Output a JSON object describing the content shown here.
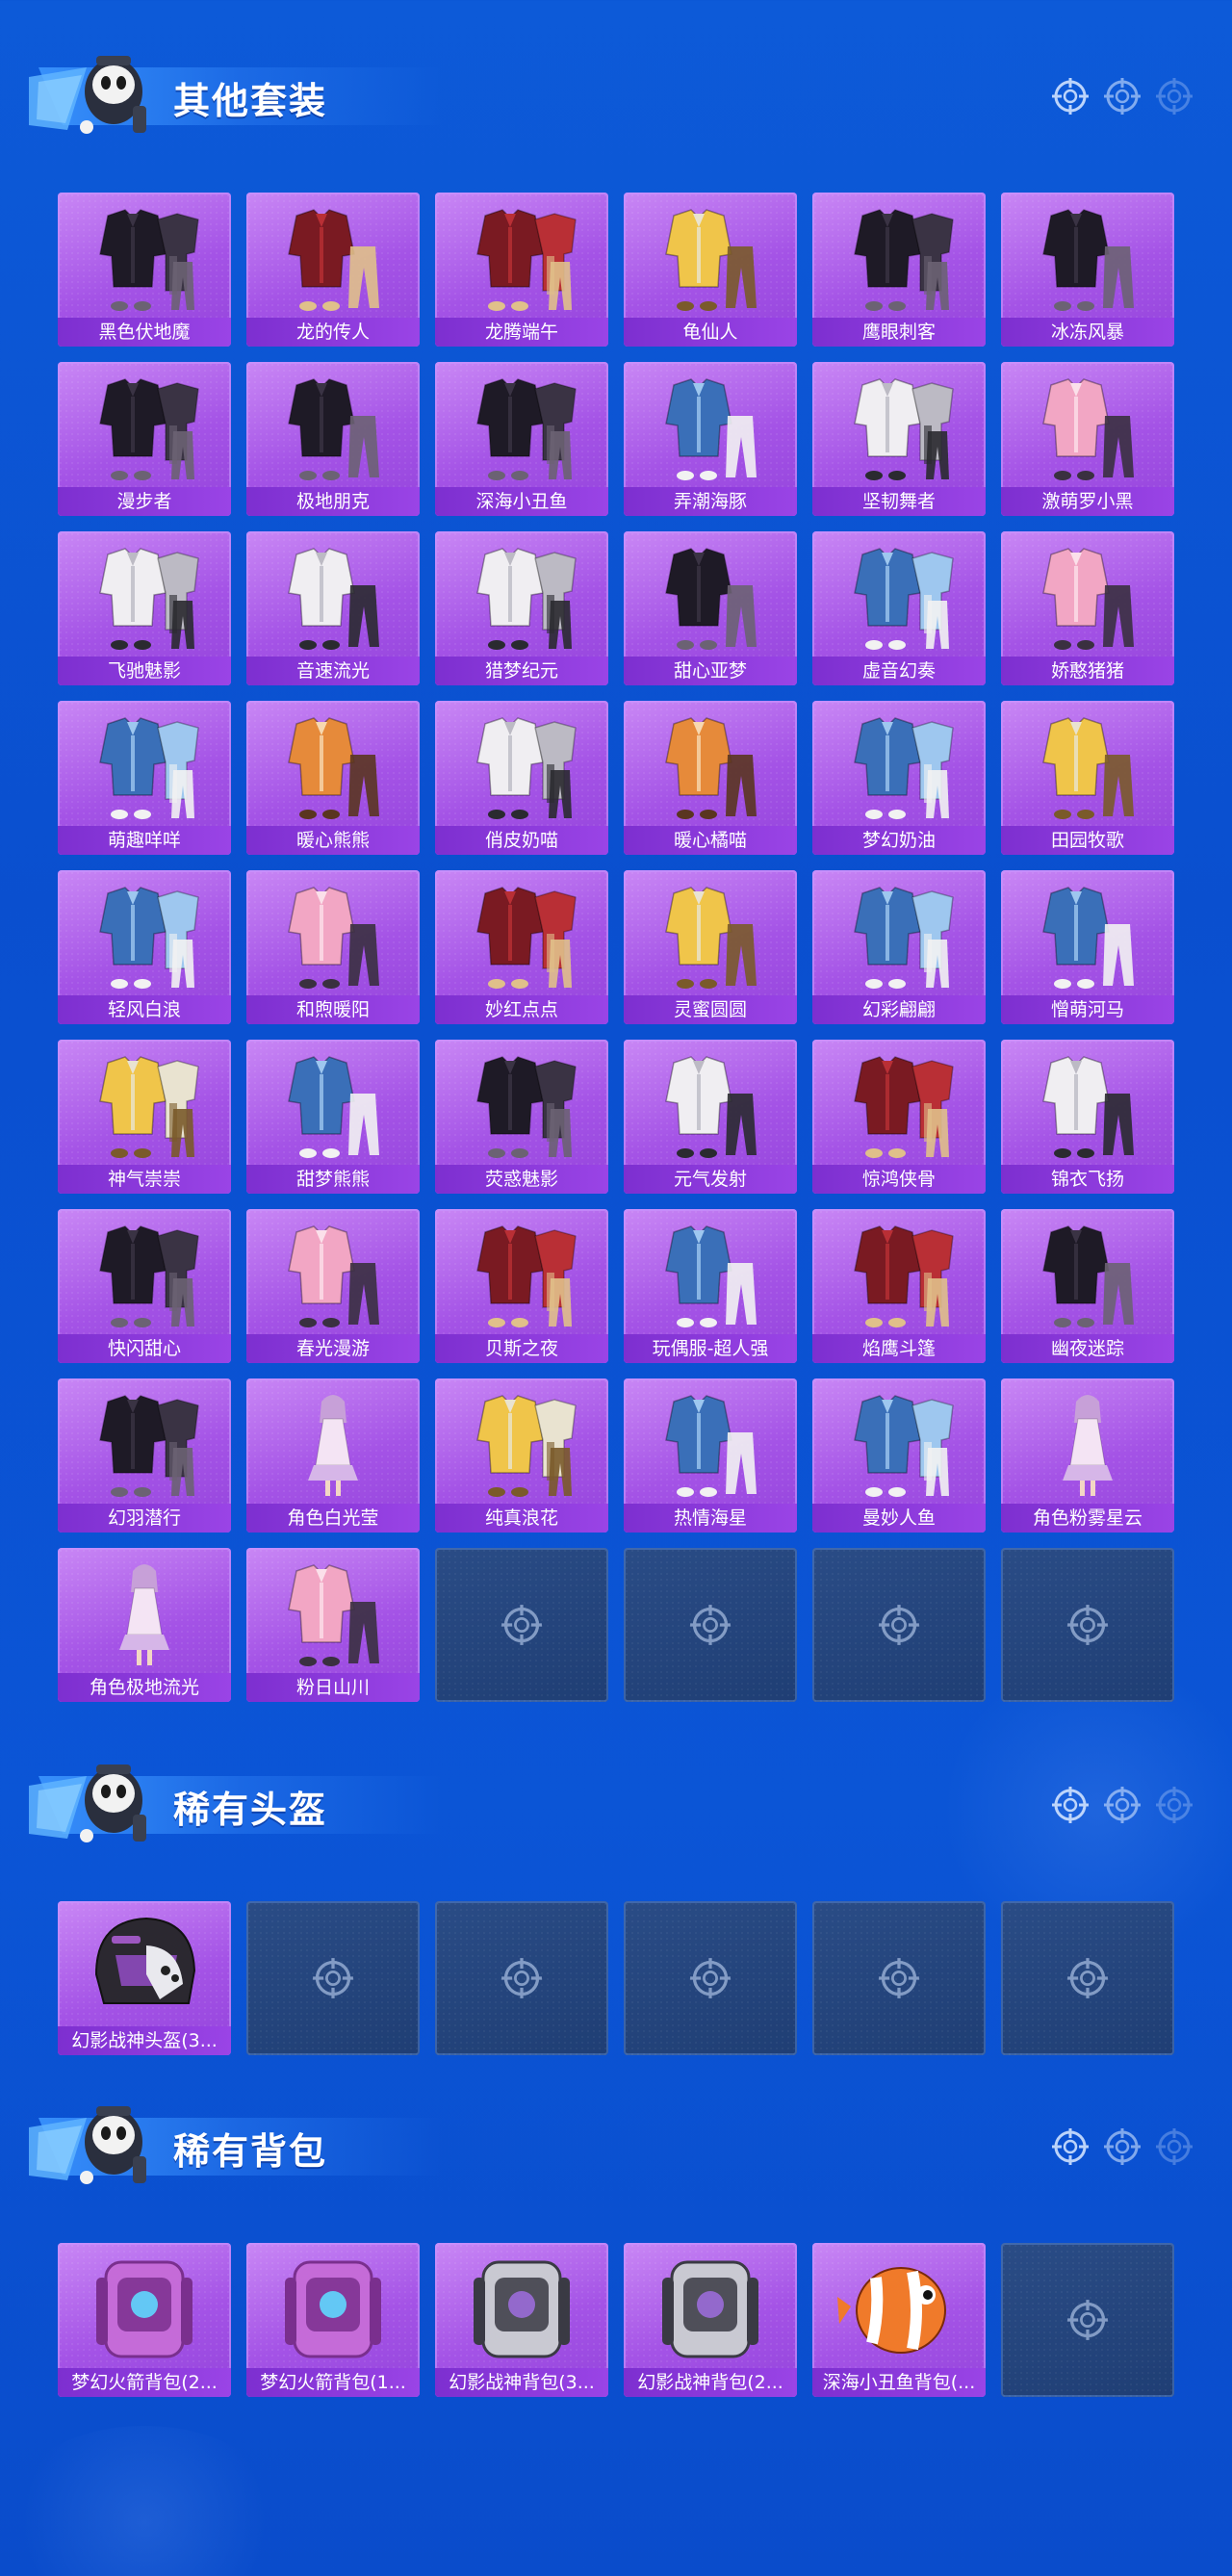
{
  "sections": [
    {
      "title": "其他套装",
      "items": [
        {
          "label": "黑色伏地魔",
          "style": "dark"
        },
        {
          "label": "龙的传人",
          "style": "red"
        },
        {
          "label": "龙腾端午",
          "style": "red"
        },
        {
          "label": "龟仙人",
          "style": "yellow"
        },
        {
          "label": "鹰眼刺客",
          "style": "dark"
        },
        {
          "label": "冰冻风暴",
          "style": "dark"
        },
        {
          "label": "漫步者",
          "style": "dark"
        },
        {
          "label": "极地朋克",
          "style": "dark"
        },
        {
          "label": "深海小丑鱼",
          "style": "dark"
        },
        {
          "label": "弄潮海豚",
          "style": "blue"
        },
        {
          "label": "坚韧舞者",
          "style": "white"
        },
        {
          "label": "激萌罗小黑",
          "style": "pink"
        },
        {
          "label": "飞驰魅影",
          "style": "white"
        },
        {
          "label": "音速流光",
          "style": "white"
        },
        {
          "label": "猎梦纪元",
          "style": "white"
        },
        {
          "label": "甜心亚梦",
          "style": "dark"
        },
        {
          "label": "虚音幻奏",
          "style": "blue"
        },
        {
          "label": "娇憨猪猪",
          "style": "pink"
        },
        {
          "label": "萌趣咩咩",
          "style": "blue"
        },
        {
          "label": "暖心熊熊",
          "style": "orange"
        },
        {
          "label": "俏皮奶喵",
          "style": "white"
        },
        {
          "label": "暖心橘喵",
          "style": "orange"
        },
        {
          "label": "梦幻奶油",
          "style": "blue"
        },
        {
          "label": "田园牧歌",
          "style": "yellow"
        },
        {
          "label": "轻风白浪",
          "style": "blue"
        },
        {
          "label": "和煦暖阳",
          "style": "pink"
        },
        {
          "label": "妙红点点",
          "style": "red"
        },
        {
          "label": "灵蜜圆圆",
          "style": "yellow"
        },
        {
          "label": "幻彩翩翩",
          "style": "blue"
        },
        {
          "label": "憎萌河马",
          "style": "blue"
        },
        {
          "label": "神气崇崇",
          "style": "yellow"
        },
        {
          "label": "甜梦熊熊",
          "style": "blue"
        },
        {
          "label": "荧惑魅影",
          "style": "dark"
        },
        {
          "label": "元气发射",
          "style": "white"
        },
        {
          "label": "惊鸿侠骨",
          "style": "red"
        },
        {
          "label": "锦衣飞扬",
          "style": "white"
        },
        {
          "label": "快闪甜心",
          "style": "dark"
        },
        {
          "label": "春光漫游",
          "style": "pink"
        },
        {
          "label": "贝斯之夜",
          "style": "red"
        },
        {
          "label": "玩偶服-超人强",
          "style": "blue"
        },
        {
          "label": "焰鹰斗篷",
          "style": "red"
        },
        {
          "label": "幽夜迷踪",
          "style": "dark"
        },
        {
          "label": "幻羽潜行",
          "style": "dark"
        },
        {
          "label": "角色白光莹",
          "style": "char"
        },
        {
          "label": "纯真浪花",
          "style": "yellow"
        },
        {
          "label": "热情海星",
          "style": "blue"
        },
        {
          "label": "曼妙人鱼",
          "style": "blue"
        },
        {
          "label": "角色粉雾星云",
          "style": "char"
        },
        {
          "label": "角色极地流光",
          "style": "char"
        },
        {
          "label": "粉日山川",
          "style": "pink"
        }
      ],
      "empty_slots": 4
    },
    {
      "title": "稀有头盔",
      "items": [
        {
          "label": "幻影战神头盔(3...",
          "style": "helmet"
        }
      ],
      "empty_slots": 5
    },
    {
      "title": "稀有背包",
      "items": [
        {
          "label": "梦幻火箭背包(2...",
          "style": "bag-pink"
        },
        {
          "label": "梦幻火箭背包(1...",
          "style": "bag-pink"
        },
        {
          "label": "幻影战神背包(3...",
          "style": "bag-gray"
        },
        {
          "label": "幻影战神背包(2...",
          "style": "bag-gray"
        },
        {
          "label": "深海小丑鱼背包(...",
          "style": "bag-orange"
        }
      ],
      "empty_slots": 1
    }
  ],
  "colors": {
    "background": "#0a4fcf",
    "card_purple": "#a453e6",
    "label_purple": "#7d2fd0",
    "empty_card": "#1f3e74"
  },
  "icons": [
    "target-icon",
    "mascot-emblem-icon"
  ]
}
